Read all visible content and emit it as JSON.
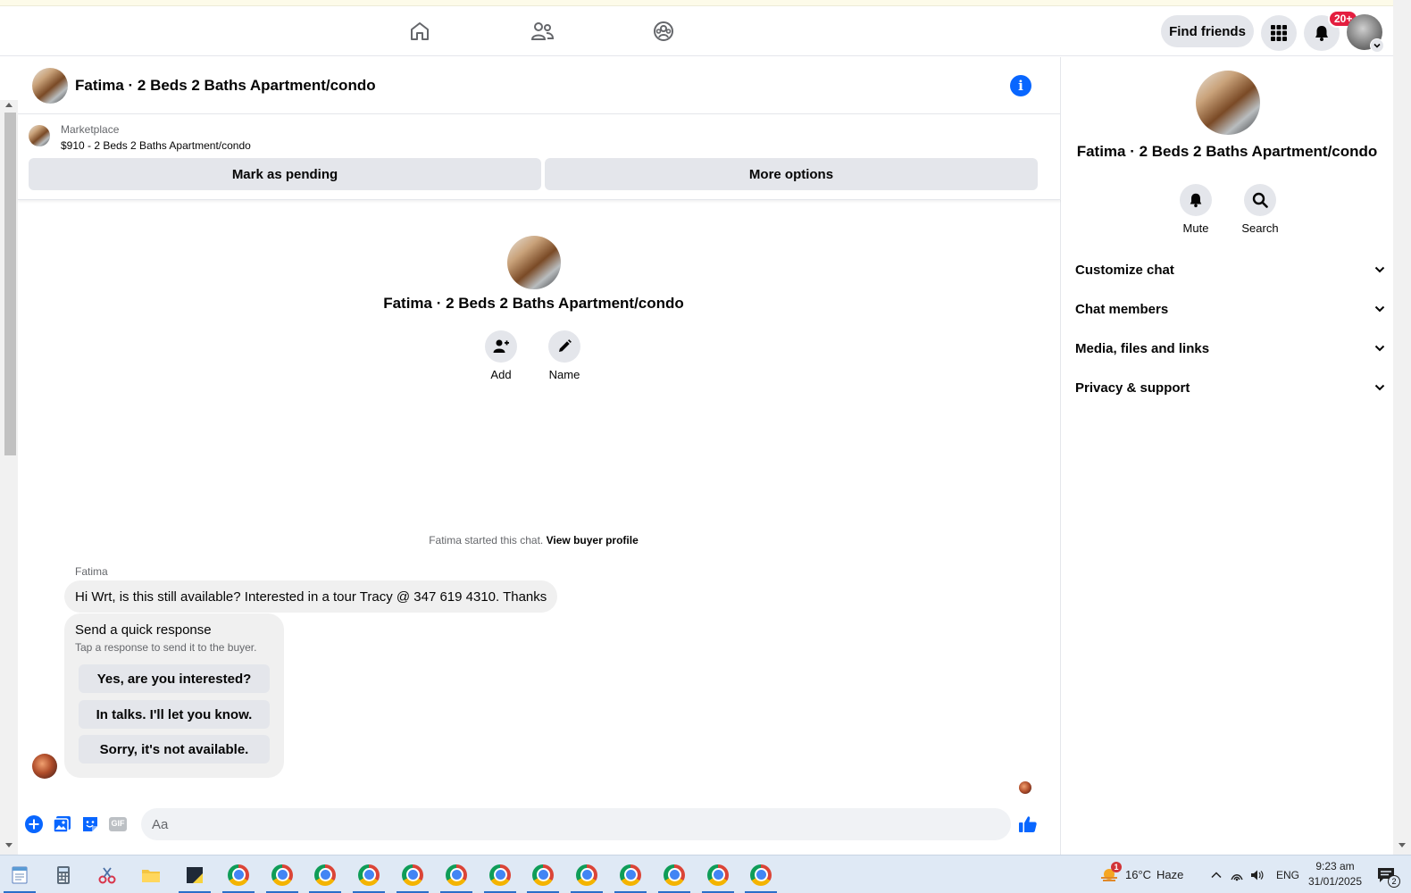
{
  "header": {
    "find_friends_label": "Find friends",
    "notification_count": "20+"
  },
  "chat": {
    "title": "Fatima · 2 Beds 2 Baths Apartment/condo",
    "marketplace": {
      "label": "Marketplace",
      "listing": "$910 - 2 Beds 2 Baths Apartment/condo",
      "mark_pending_label": "Mark as pending",
      "more_options_label": "More options"
    },
    "intro": {
      "title": "Fatima · 2 Beds 2 Baths Apartment/condo",
      "add_label": "Add",
      "name_label": "Name"
    },
    "started_text": "Fatima started this chat.",
    "view_profile_link": "View buyer profile",
    "sender_name": "Fatima",
    "message": "Hi Wrt, is this still available? Interested  in a tour Tracy @ 347 619 4310.  Thanks",
    "quick_response": {
      "title": "Send a quick response",
      "subtitle": "Tap a response to send it to the buyer.",
      "options": [
        "Yes, are you interested?",
        "In talks. I'll let you know.",
        "Sorry, it's not available."
      ]
    },
    "composer": {
      "placeholder": "Aa",
      "gif_label": "GIF"
    }
  },
  "right_panel": {
    "title": "Fatima · 2 Beds 2 Baths Apartment/condo",
    "mute_label": "Mute",
    "search_label": "Search",
    "sections": [
      "Customize chat",
      "Chat members",
      "Media, files and links",
      "Privacy & support"
    ]
  },
  "taskbar": {
    "weather_badge": "1",
    "temperature": "16°C",
    "condition": "Haze",
    "language": "ENG",
    "time": "9:23 am",
    "date": "31/01/2025",
    "notification_count": "2"
  },
  "colors": {
    "accent": "#0866ff",
    "badge": "#e41e3f",
    "button_bg": "#e4e6eb",
    "bubble_bg": "#f0f0f0"
  }
}
